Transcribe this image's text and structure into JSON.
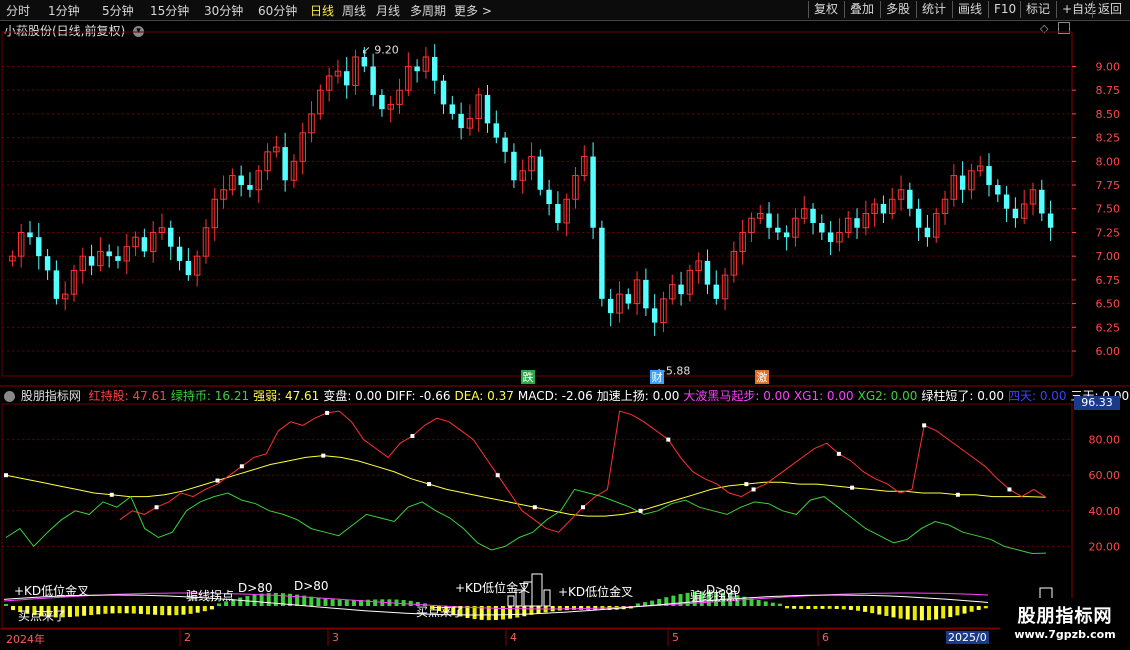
{
  "toolbar": {
    "periods": [
      "分时",
      "1分钟",
      "5分钟",
      "15分钟",
      "30分钟",
      "60分钟",
      "日线",
      "周线",
      "月线",
      "多周期",
      "更多 >"
    ],
    "active": "日线",
    "right_buttons": [
      "复权",
      "叠加",
      "多股",
      "统计",
      "画线",
      "F10",
      "标记",
      "+自选",
      "返回"
    ]
  },
  "main": {
    "title": "小菘股份(日线,前复权)",
    "diamond_icon": "diamond-icon",
    "price_axis": [
      "9.00",
      "8.75",
      "8.50",
      "8.25",
      "8.00",
      "7.75",
      "7.50",
      "7.25",
      "7.00",
      "6.75",
      "6.50",
      "6.25",
      "6.00"
    ],
    "high_label": "9.20",
    "low_label": "5.88",
    "markers": [
      {
        "text": "跌",
        "color": "#2aa84a"
      },
      {
        "text": "财",
        "color": "#3aa0ff"
      },
      {
        "text": "激",
        "color": "#e07020"
      }
    ]
  },
  "indicator": {
    "name": "股朋指标网",
    "fields": [
      {
        "label": "红持股:",
        "value": "47.61",
        "color": "#ff4040"
      },
      {
        "label": "绿持币:",
        "value": "16.21",
        "color": "#3cd03c"
      },
      {
        "label": "强弱:",
        "value": "47.61",
        "color": "#ffff40"
      },
      {
        "label": "变盘:",
        "value": "0.00",
        "color": "#ffffff"
      },
      {
        "label": "DIFF:",
        "value": "-0.66",
        "color": "#ffffff"
      },
      {
        "label": "DEA:",
        "value": "0.37",
        "color": "#ffff40"
      },
      {
        "label": "MACD:",
        "value": "-2.06",
        "color": "#ffffff"
      },
      {
        "label": "加速上扬:",
        "value": "0.00",
        "color": "#ffffff"
      },
      {
        "label": "大波黑马起步:",
        "value": "0.00",
        "color": "#ff40ff"
      },
      {
        "label": "XG1:",
        "value": "0.00",
        "color": "#ff40ff"
      },
      {
        "label": "XG2:",
        "value": "0.00",
        "color": "#3cd03c"
      },
      {
        "label": "绿柱短了:",
        "value": "0.00",
        "color": "#ffffff"
      },
      {
        "label": "四天:",
        "value": "0.00",
        "color": "#4040ff"
      },
      {
        "label": "三天:",
        "value": "0.00",
        "color": "#ffffff"
      }
    ],
    "current_value": "96.33",
    "axis": [
      "80.00",
      "60.00",
      "40.00",
      "20.00"
    ],
    "annotations": [
      "KD低位金叉",
      "KD低位金叉",
      "KD低位金叉",
      "骗线拐点",
      "骗线拐点",
      "D>80",
      "D>80",
      "D>80",
      "买点来了",
      "买点来了"
    ]
  },
  "dates": [
    "2024年",
    "2",
    "3",
    "4",
    "5",
    "6",
    "2025/0"
  ],
  "logo": {
    "main": "股朋指标网",
    "sub": "www.7gpzb.com"
  },
  "colors": {
    "up": "#ff3232",
    "down": "#54ffff",
    "grid": "#6a0000"
  },
  "chart_data": {
    "type": "candlestick",
    "closes": [
      7.0,
      7.25,
      7.2,
      7.0,
      6.85,
      6.55,
      6.6,
      6.85,
      7.0,
      6.9,
      7.05,
      7.0,
      6.95,
      7.1,
      7.2,
      7.05,
      7.25,
      7.3,
      7.1,
      6.95,
      6.8,
      7.0,
      7.3,
      7.6,
      7.7,
      7.85,
      7.75,
      7.7,
      7.9,
      8.1,
      8.15,
      7.8,
      8.0,
      8.3,
      8.5,
      8.75,
      8.9,
      8.95,
      8.8,
      9.1,
      9.0,
      8.7,
      8.55,
      8.6,
      8.75,
      9.0,
      8.95,
      9.1,
      8.85,
      8.6,
      8.5,
      8.35,
      8.45,
      8.7,
      8.4,
      8.25,
      8.1,
      7.8,
      7.9,
      8.05,
      7.7,
      7.55,
      7.35,
      7.6,
      7.85,
      8.05,
      7.3,
      6.55,
      6.4,
      6.6,
      6.5,
      6.75,
      6.45,
      6.3,
      6.55,
      6.7,
      6.6,
      6.85,
      6.95,
      6.7,
      6.55,
      6.8,
      7.05,
      7.25,
      7.4,
      7.45,
      7.3,
      7.25,
      7.2,
      7.4,
      7.5,
      7.35,
      7.25,
      7.15,
      7.25,
      7.4,
      7.3,
      7.45,
      7.55,
      7.45,
      7.6,
      7.7,
      7.5,
      7.3,
      7.2,
      7.45,
      7.6,
      7.85,
      7.7,
      7.9,
      7.95,
      7.75,
      7.65,
      7.5,
      7.4,
      7.55,
      7.7,
      7.45,
      7.3
    ],
    "high_value": 9.2,
    "low_value": 5.88,
    "ylim": [
      5.8,
      9.3
    ],
    "kd_red": [
      35,
      40,
      38,
      42,
      45,
      50,
      48,
      52,
      55,
      60,
      65,
      70,
      72,
      85,
      90,
      88,
      92,
      95,
      96,
      90,
      80,
      75,
      70,
      78,
      82,
      88,
      92,
      90,
      85,
      80,
      70,
      60,
      50,
      40,
      35,
      30,
      28,
      35,
      42,
      48,
      52,
      96,
      94,
      90,
      85,
      80,
      70,
      62,
      58,
      55,
      50,
      48,
      52,
      55,
      60,
      65,
      70,
      75,
      78,
      72,
      68,
      62,
      58,
      55,
      50,
      52,
      88,
      85,
      80,
      75,
      70,
      65,
      58,
      52,
      48,
      52,
      47.61
    ],
    "kd_green": [
      25,
      30,
      20,
      28,
      35,
      40,
      38,
      45,
      42,
      48,
      30,
      25,
      28,
      40,
      45,
      48,
      50,
      46,
      44,
      40,
      38,
      35,
      30,
      28,
      26,
      32,
      38,
      36,
      34,
      42,
      45,
      40,
      36,
      30,
      22,
      18,
      20,
      25,
      28,
      35,
      40,
      52,
      50,
      48,
      45,
      42,
      38,
      40,
      44,
      46,
      42,
      40,
      38,
      42,
      45,
      44,
      40,
      38,
      46,
      48,
      42,
      36,
      30,
      26,
      22,
      24,
      30,
      34,
      32,
      28,
      26,
      24,
      20,
      18,
      16,
      16.21
    ],
    "kd_yellow": [
      60,
      58,
      56,
      54,
      52,
      50,
      49,
      48,
      48,
      49,
      51,
      54,
      57,
      60,
      63,
      66,
      68,
      70,
      71,
      70,
      68,
      65,
      62,
      58,
      55,
      52,
      50,
      48,
      46,
      44,
      42,
      40,
      38,
      37,
      37,
      38,
      40,
      43,
      46,
      49,
      52,
      54,
      55,
      56,
      56,
      55,
      55,
      54,
      53,
      52,
      51,
      51,
      50,
      50,
      49,
      49,
      48,
      48,
      48,
      47.61
    ],
    "indicator_ylim": [
      0,
      100
    ]
  }
}
